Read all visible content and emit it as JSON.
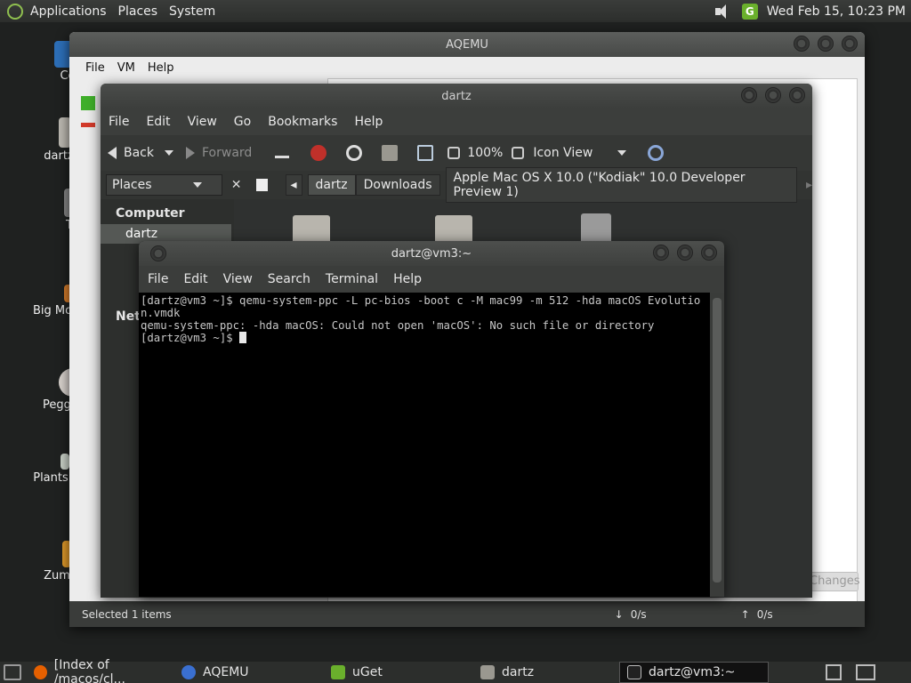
{
  "top_panel": {
    "menu": [
      "Applications",
      "Places",
      "System"
    ],
    "clock": "Wed Feb 15, 10:23 PM",
    "tray_icons": [
      "volume-icon",
      "uget-icon"
    ]
  },
  "desktop": {
    "icons": [
      {
        "label": "Co"
      },
      {
        "label": "dartz"
      },
      {
        "label": "T"
      },
      {
        "label": "Big Mo"
      },
      {
        "label": "Pegg"
      },
      {
        "label": "Plants"
      },
      {
        "label": "Zum"
      }
    ]
  },
  "aqemu": {
    "title": "AQEMU",
    "menu": [
      "File",
      "VM",
      "Help"
    ],
    "changes_button": "Changes",
    "status": {
      "selected": "Selected 1 items",
      "down": "0/s",
      "up": "0/s"
    }
  },
  "nautilus": {
    "title": "dartz",
    "menu": [
      "File",
      "Edit",
      "View",
      "Go",
      "Bookmarks",
      "Help"
    ],
    "toolbar": {
      "back": "Back",
      "forward": "Forward",
      "zoom": "100%",
      "view_mode": "Icon View"
    },
    "places_label": "Places",
    "breadcrumbs": [
      "dartz",
      "Downloads",
      "Apple Mac OS X 10.0 (\"Kodiak\" 10.0 Developer Preview 1)"
    ],
    "sidebar": {
      "heading": "Computer",
      "selected_item": "dartz",
      "network_heading": "Netw"
    }
  },
  "terminal": {
    "title": "dartz@vm3:~",
    "menu": [
      "File",
      "Edit",
      "View",
      "Search",
      "Terminal",
      "Help"
    ],
    "lines": [
      "[dartz@vm3 ~]$ qemu-system-ppc -L pc-bios -boot c -M mac99 -m 512 -hda macOS Evolution.vmdk",
      "qemu-system-ppc: -hda macOS: Could not open 'macOS': No such file or directory",
      "[dartz@vm3 ~]$ "
    ]
  },
  "taskbar": {
    "tasks": [
      {
        "label": "[Index of /macos/cl...",
        "icon": "firefox-icon"
      },
      {
        "label": "AQEMU",
        "icon": "aqemu-icon"
      },
      {
        "label": "uGet",
        "icon": "uget-icon"
      },
      {
        "label": "dartz",
        "icon": "home-folder-icon"
      },
      {
        "label": "dartz@vm3:~",
        "icon": "terminal-icon"
      }
    ]
  }
}
